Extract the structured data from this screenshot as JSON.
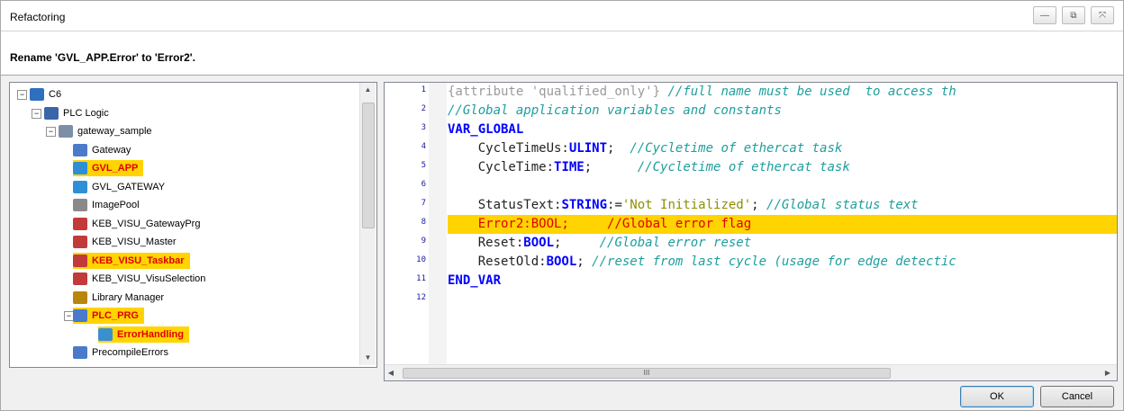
{
  "window": {
    "title": "Refactoring",
    "btn_minimize": "—",
    "btn_restore": "⧉",
    "btn_close": "⤧"
  },
  "header": {
    "message": "Rename 'GVL_APP.Error' to 'Error2'."
  },
  "tree": [
    {
      "label": "C6",
      "exp": "⊟",
      "icon": "plc-device-icon",
      "color": "#2f6fbf",
      "highlight": false
    },
    {
      "label": "PLC Logic",
      "exp": "⊟",
      "icon": "plc-logic-icon",
      "color": "#3a66a8",
      "highlight": false
    },
    {
      "label": "gateway_sample",
      "exp": "⊟",
      "icon": "application-gear-icon",
      "color": "#7d8ea6",
      "highlight": false
    },
    {
      "label": "Gateway",
      "exp": "",
      "icon": "pou-program-icon",
      "color": "#4a7ac9",
      "highlight": false
    },
    {
      "label": "GVL_APP",
      "exp": "",
      "icon": "global-variable-list-icon",
      "color": "#2f8fd6",
      "highlight": true
    },
    {
      "label": "GVL_GATEWAY",
      "exp": "",
      "icon": "global-variable-list-icon",
      "color": "#2f8fd6",
      "highlight": false
    },
    {
      "label": "ImagePool",
      "exp": "",
      "icon": "image-pool-icon",
      "color": "#8a8a8a",
      "highlight": false
    },
    {
      "label": "KEB_VISU_GatewayPrg",
      "exp": "",
      "icon": "visualization-icon",
      "color": "#c23a3a",
      "highlight": false
    },
    {
      "label": "KEB_VISU_Master",
      "exp": "",
      "icon": "visualization-icon",
      "color": "#c23a3a",
      "highlight": false
    },
    {
      "label": "KEB_VISU_Taskbar",
      "exp": "",
      "icon": "visualization-icon",
      "color": "#c23a3a",
      "highlight": true
    },
    {
      "label": "KEB_VISU_VisuSelection",
      "exp": "",
      "icon": "visualization-icon",
      "color": "#c23a3a",
      "highlight": false
    },
    {
      "label": "Library Manager",
      "exp": "",
      "icon": "library-manager-icon",
      "color": "#b8860b",
      "highlight": false
    },
    {
      "label": "PLC_PRG",
      "exp": "⊟",
      "icon": "pou-program-icon",
      "color": "#4a7ac9",
      "highlight": true
    },
    {
      "label": "ErrorHandling",
      "exp": "",
      "icon": "action-icon",
      "color": "#3a8fd1",
      "highlight": true
    },
    {
      "label": "PrecompileErrors",
      "exp": "",
      "icon": "pou-program-icon",
      "color": "#4a7ac9",
      "highlight": false
    }
  ],
  "code": {
    "line_numbers": [
      "1",
      "2",
      "3",
      "4",
      "5",
      "6",
      "7",
      "8",
      "9",
      "10",
      "11",
      "12"
    ],
    "lines": [
      [
        {
          "t": "{attribute 'qualified_only'} ",
          "c": "attr"
        },
        {
          "t": "//full name must be used  to access th",
          "c": "cm"
        }
      ],
      [
        {
          "t": "//Global application variables and constants",
          "c": "cm"
        }
      ],
      [
        {
          "t": "VAR_GLOBAL",
          "c": "kw"
        }
      ],
      [
        {
          "t": "    CycleTimeUs:",
          "c": "id"
        },
        {
          "t": "ULINT",
          "c": "kw"
        },
        {
          "t": ";  ",
          "c": "id"
        },
        {
          "t": "//Cycletime of ethercat task",
          "c": "cm"
        }
      ],
      [
        {
          "t": "    CycleTime:",
          "c": "id"
        },
        {
          "t": "TIME",
          "c": "kw"
        },
        {
          "t": ";      ",
          "c": "id"
        },
        {
          "t": "//Cycletime of ethercat task",
          "c": "cm"
        }
      ],
      [],
      [
        {
          "t": "    StatusText:",
          "c": "id"
        },
        {
          "t": "STRING",
          "c": "kw"
        },
        {
          "t": ":=",
          "c": "id"
        },
        {
          "t": "'Not Initialized'",
          "c": "str"
        },
        {
          "t": "; ",
          "c": "id"
        },
        {
          "t": "//Global status text",
          "c": "cm"
        }
      ],
      [
        {
          "t": "    Error2:BOOL;     //Global error flag",
          "c": "idr"
        }
      ],
      [
        {
          "t": "    Reset:",
          "c": "id"
        },
        {
          "t": "BOOL",
          "c": "kw"
        },
        {
          "t": ";     ",
          "c": "id"
        },
        {
          "t": "//Global error reset",
          "c": "cm"
        }
      ],
      [
        {
          "t": "    ResetOld:",
          "c": "id"
        },
        {
          "t": "BOOL",
          "c": "kw"
        },
        {
          "t": "; ",
          "c": "id"
        },
        {
          "t": "//reset from last cycle (usage for edge detectic",
          "c": "cm"
        }
      ],
      [
        {
          "t": "END_VAR",
          "c": "kw"
        }
      ],
      []
    ],
    "highlight_line": 8
  },
  "scroll": {
    "grip": "III"
  },
  "buttons": {
    "ok": "OK",
    "cancel": "Cancel"
  }
}
